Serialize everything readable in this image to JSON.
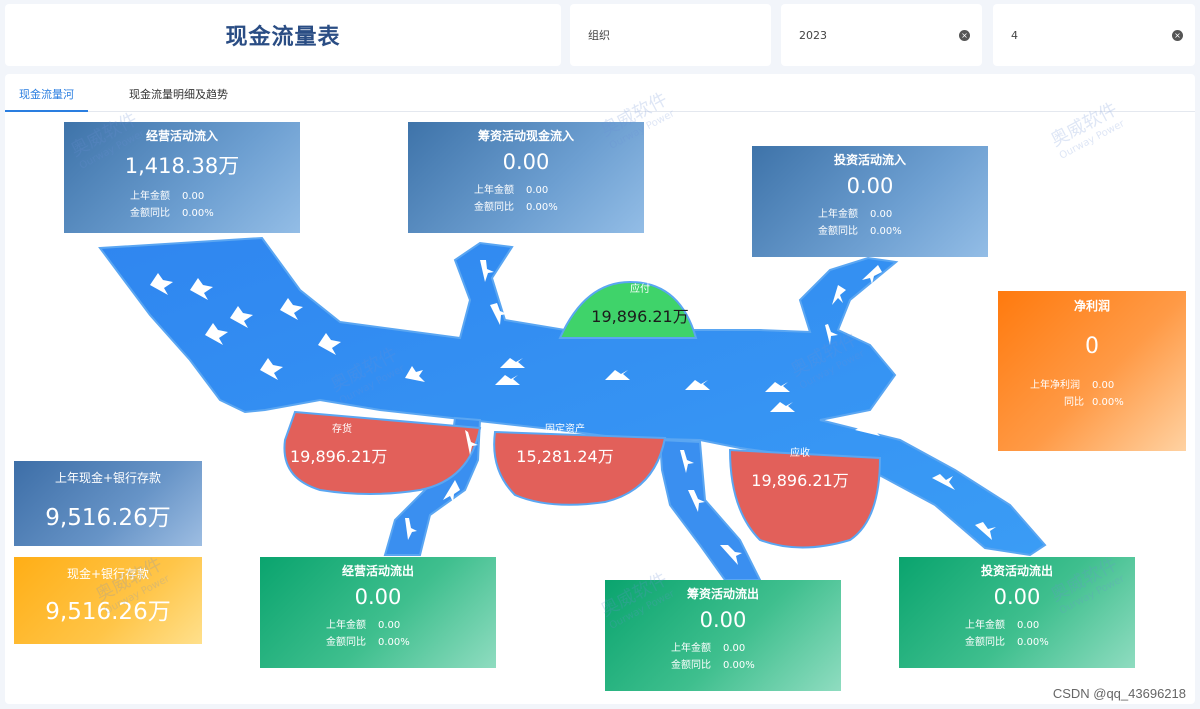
{
  "header": {
    "title": "现金流量表"
  },
  "filters": {
    "org": {
      "label": "组织"
    },
    "year": {
      "value": "2023",
      "clear": "×"
    },
    "month": {
      "value": "4",
      "clear": "×"
    }
  },
  "tabs": [
    {
      "label": "现金流量河",
      "active": true
    },
    {
      "label": "现金流量明细及趋势",
      "active": false
    }
  ],
  "cards": {
    "op_in": {
      "title": "经营活动流入",
      "value": "1,418.38万",
      "prev_label": "上年金额",
      "prev_value": "0.00",
      "yoy_label": "金额同比",
      "yoy_value": "0.00%"
    },
    "fin_in": {
      "title": "筹资活动现金流入",
      "value": "0.00",
      "prev_label": "上年金额",
      "prev_value": "0.00",
      "yoy_label": "金额同比",
      "yoy_value": "0.00%"
    },
    "inv_in": {
      "title": "投资活动流入",
      "value": "0.00",
      "prev_label": "上年金额",
      "prev_value": "0.00",
      "yoy_label": "金额同比",
      "yoy_value": "0.00%"
    },
    "profit": {
      "title": "净利润",
      "value": "0",
      "prev_label": "上年净利润",
      "prev_value": "0.00",
      "yoy_label": "同比",
      "yoy_value": "0.00%"
    },
    "prev_cash": {
      "title": "上年现金+银行存款",
      "value": "9,516.26万"
    },
    "cur_cash": {
      "title": "现金+银行存款",
      "value": "9,516.26万"
    },
    "op_out": {
      "title": "经营活动流出",
      "value": "0.00",
      "prev_label": "上年金额",
      "prev_value": "0.00",
      "yoy_label": "金额同比",
      "yoy_value": "0.00%"
    },
    "fin_out": {
      "title": "筹资活动流出",
      "value": "0.00",
      "prev_label": "上年金额",
      "prev_value": "0.00",
      "yoy_label": "金额同比",
      "yoy_value": "0.00%"
    },
    "inv_out": {
      "title": "投资活动流出",
      "value": "0.00",
      "prev_label": "上年金额",
      "prev_value": "0.00",
      "yoy_label": "金额同比",
      "yoy_value": "0.00%"
    }
  },
  "blobs": {
    "payable": {
      "label": "应付",
      "value": "19,896.21万"
    },
    "inventory": {
      "label": "存货",
      "value": "19,896.21万"
    },
    "fixed": {
      "label": "固定资产",
      "value": "15,281.24万"
    },
    "receivable": {
      "label": "应收",
      "value": "19,896.21万"
    }
  },
  "watermark": {
    "cn": "奥威软件",
    "en": "Ourway Power"
  },
  "footer": {
    "credit": "CSDN @qq_43696218"
  },
  "colors": {
    "river": "#3b8bea",
    "payable": "#3fd36a",
    "debt_blob": "#e2605a",
    "brand": "#2a4d84"
  }
}
